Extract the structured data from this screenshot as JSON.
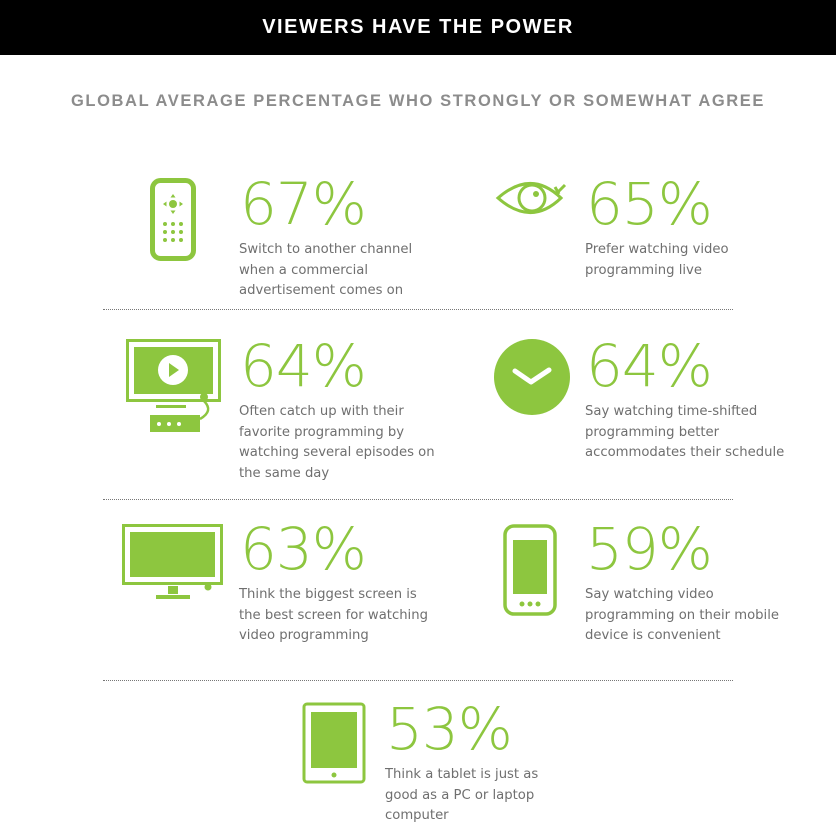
{
  "header": {
    "title": "VIEWERS HAVE THE POWER"
  },
  "subtitle": "GLOBAL AVERAGE PERCENTAGE WHO STRONGLY OR SOMEWHAT AGREE",
  "accent_color": "#8dc63f",
  "stats": [
    {
      "icon": "remote-control-icon",
      "percent": "67%",
      "value": 67,
      "description": "Switch to another channel when a commercial advertisement comes on"
    },
    {
      "icon": "eye-icon",
      "percent": "65%",
      "value": 65,
      "description": "Prefer watching video programming live"
    },
    {
      "icon": "tv-with-set-top-box-icon",
      "percent": "64%",
      "value": 64,
      "description": "Often catch up with their favorite programming by watching several episodes on the same day"
    },
    {
      "icon": "clock-icon",
      "percent": "64%",
      "value": 64,
      "description": "Say watching time-shifted programming better accommodates their schedule"
    },
    {
      "icon": "big-screen-tv-icon",
      "percent": "63%",
      "value": 63,
      "description": "Think the biggest screen is the best screen for watching video programming"
    },
    {
      "icon": "mobile-phone-icon",
      "percent": "59%",
      "value": 59,
      "description": "Say watching video programming on their mobile device is convenient"
    },
    {
      "icon": "tablet-icon",
      "percent": "53%",
      "value": 53,
      "description": "Think a tablet is just as good as a PC or laptop computer"
    }
  ]
}
